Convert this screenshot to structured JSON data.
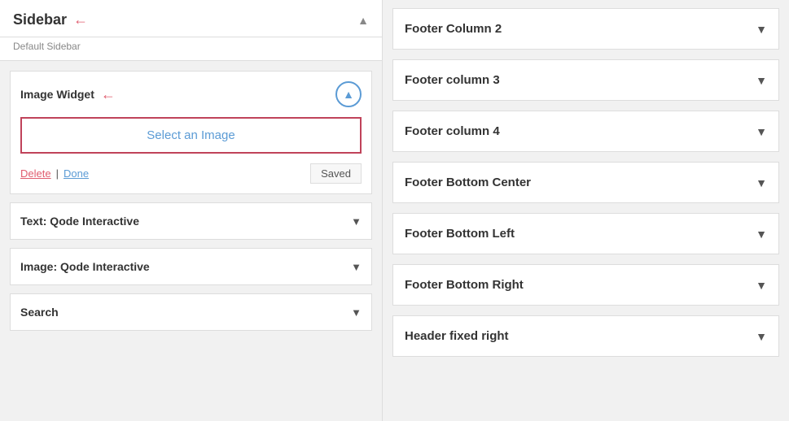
{
  "leftPanel": {
    "sidebar": {
      "title": "Sidebar",
      "subtitle": "Default Sidebar",
      "arrowLabel": "←"
    },
    "imageWidget": {
      "title": "Image Widget",
      "arrowLabel": "←",
      "selectImageLabel": "Select an Image",
      "deleteLabel": "Delete",
      "separator": "|",
      "doneLabel": "Done",
      "savedLabel": "Saved"
    },
    "collapsibleItems": [
      {
        "label": "Text: Qode Interactive"
      },
      {
        "label": "Image: Qode Interactive"
      },
      {
        "label": "Search"
      }
    ]
  },
  "rightPanel": {
    "items": [
      {
        "label": "Footer Column 2"
      },
      {
        "label": "Footer column 3"
      },
      {
        "label": "Footer column 4"
      },
      {
        "label": "Footer Bottom Center"
      },
      {
        "label": "Footer Bottom Left"
      },
      {
        "label": "Footer Bottom Right"
      },
      {
        "label": "Header fixed right"
      }
    ]
  },
  "icons": {
    "arrowLeft": "←",
    "chevronUp": "▲",
    "chevronDown": "▼"
  }
}
